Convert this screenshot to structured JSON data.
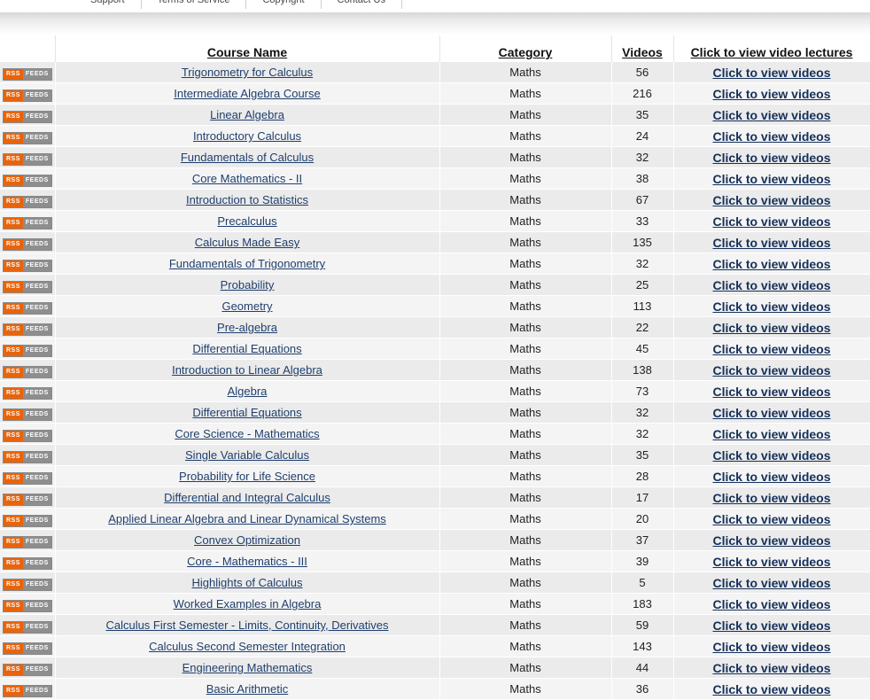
{
  "nav": {
    "items": [
      "Support",
      "Terms of Service",
      "Copyright",
      "Contact Us"
    ]
  },
  "table": {
    "headers": {
      "course_name": "Course Name",
      "category": "Category",
      "videos": "Videos",
      "link": "Click to view video lectures"
    },
    "rss_badge": {
      "left": "RSS",
      "right": "FEEDS"
    },
    "link_label": "Click to view videos",
    "rows": [
      {
        "name": "Trigonometry for Calculus",
        "category": "Maths",
        "videos": "56"
      },
      {
        "name": "Intermediate Algebra Course",
        "category": "Maths",
        "videos": "216"
      },
      {
        "name": "Linear Algebra",
        "category": "Maths",
        "videos": "35"
      },
      {
        "name": "Introductory Calculus",
        "category": "Maths",
        "videos": "24"
      },
      {
        "name": "Fundamentals of Calculus",
        "category": "Maths",
        "videos": "32"
      },
      {
        "name": "Core Mathematics - II",
        "category": "Maths",
        "videos": "38"
      },
      {
        "name": "Introduction to Statistics",
        "category": "Maths",
        "videos": "67"
      },
      {
        "name": "Precalculus",
        "category": "Maths",
        "videos": "33"
      },
      {
        "name": "Calculus Made Easy",
        "category": "Maths",
        "videos": "135"
      },
      {
        "name": "Fundamentals of Trigonometry",
        "category": "Maths",
        "videos": "32"
      },
      {
        "name": "Probability",
        "category": "Maths",
        "videos": "25"
      },
      {
        "name": "Geometry",
        "category": "Maths",
        "videos": "113"
      },
      {
        "name": "Pre-algebra",
        "category": "Maths",
        "videos": "22"
      },
      {
        "name": "Differential Equations",
        "category": "Maths",
        "videos": "45"
      },
      {
        "name": "Introduction to Linear Algebra",
        "category": "Maths",
        "videos": "138"
      },
      {
        "name": "Algebra",
        "category": "Maths",
        "videos": "73"
      },
      {
        "name": "Differential Equations",
        "category": "Maths",
        "videos": "32"
      },
      {
        "name": "Core Science - Mathematics",
        "category": "Maths",
        "videos": "32"
      },
      {
        "name": "Single Variable Calculus",
        "category": "Maths",
        "videos": "35"
      },
      {
        "name": "Probability for Life Science",
        "category": "Maths",
        "videos": "28"
      },
      {
        "name": "Differential and Integral Calculus",
        "category": "Maths",
        "videos": "17"
      },
      {
        "name": "Applied Linear Algebra and Linear Dynamical Systems",
        "category": "Maths",
        "videos": "20"
      },
      {
        "name": "Convex Optimization",
        "category": "Maths",
        "videos": "37"
      },
      {
        "name": "Core - Mathematics - III",
        "category": "Maths",
        "videos": "39"
      },
      {
        "name": "Highlights of Calculus",
        "category": "Maths",
        "videos": "5"
      },
      {
        "name": "Worked Examples in Algebra",
        "category": "Maths",
        "videos": "183"
      },
      {
        "name": "Calculus First Semester - Limits, Continuity, Derivatives",
        "category": "Maths",
        "videos": "59"
      },
      {
        "name": "Calculus Second Semester Integration",
        "category": "Maths",
        "videos": "143"
      },
      {
        "name": "Engineering Mathematics",
        "category": "Maths",
        "videos": "44"
      },
      {
        "name": "Basic Arithmetic",
        "category": "Maths",
        "videos": "36"
      }
    ]
  }
}
